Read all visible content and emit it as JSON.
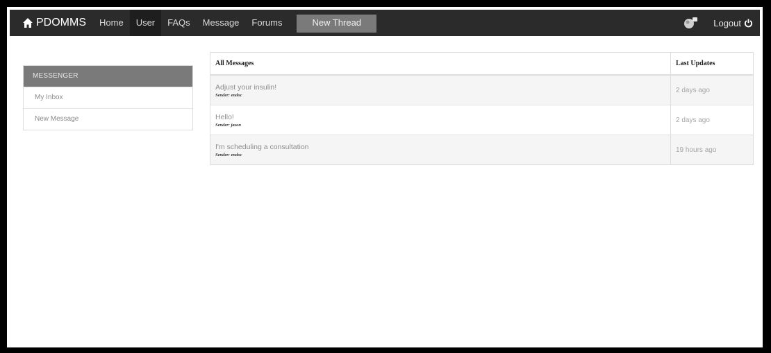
{
  "navbar": {
    "brand": "PDOMMS",
    "links": [
      "Home",
      "User",
      "FAQs",
      "Message",
      "Forums"
    ],
    "new_thread": "New Thread",
    "logout": "Logout"
  },
  "sidebar": {
    "header": "MESSENGER",
    "items": [
      {
        "label": "My Inbox"
      },
      {
        "label": "New Message"
      }
    ]
  },
  "messages": {
    "headers": {
      "subject": "All Messages",
      "updates": "Last Updates"
    },
    "rows": [
      {
        "subject": "Adjust your insulin!",
        "sender": "Sender: endoc",
        "updated": "2 days ago"
      },
      {
        "subject": "Hello!",
        "sender": "Sender: jason",
        "updated": "2 days ago"
      },
      {
        "subject": "I'm scheduling a consultation",
        "sender": "Sender: endoc",
        "updated": "19 hours ago"
      }
    ]
  }
}
